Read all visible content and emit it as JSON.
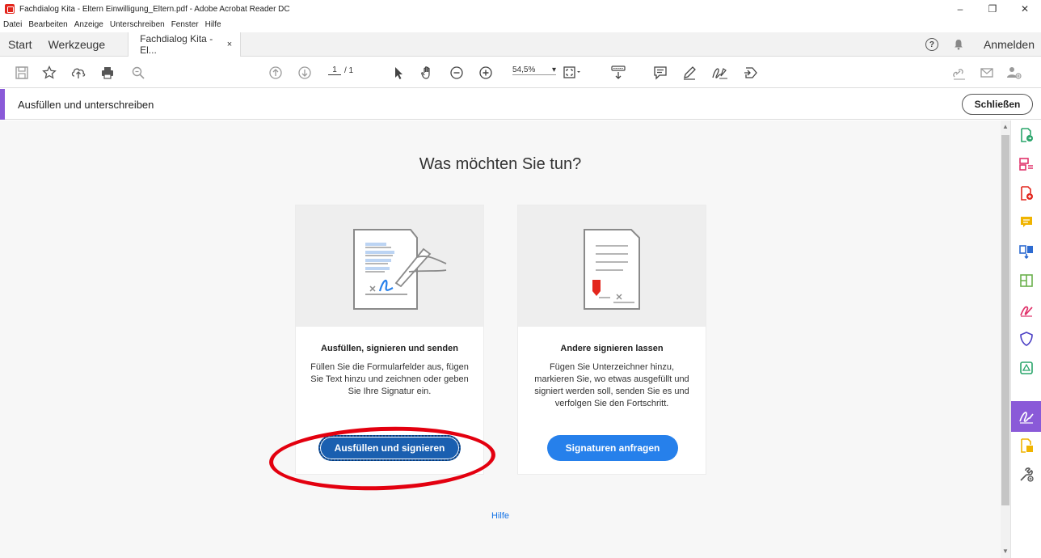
{
  "window": {
    "title": "Fachdialog Kita - Eltern Einwilligung_Eltern.pdf - Adobe Acrobat Reader DC",
    "controls": [
      "–",
      "❐",
      "✕"
    ]
  },
  "menu": [
    "Datei",
    "Bearbeiten",
    "Anzeige",
    "Unterschreiben",
    "Fenster",
    "Hilfe"
  ],
  "tabs": {
    "start": "Start",
    "tools": "Werkzeuge",
    "document": "Fachdialog Kita - El...",
    "close": "×",
    "help_icon": "?",
    "sign_in": "Anmelden"
  },
  "toolbar": {
    "page_current": "1",
    "page_total": "/ 1",
    "zoom": "54,5%",
    "zoom_arrow": "▾"
  },
  "panel": {
    "label": "Ausfüllen und unterschreiben",
    "close_label": "Schließen",
    "accent": "#8a5ad8"
  },
  "main": {
    "headline": "Was möchten Sie tun?",
    "help_link": "Hilfe",
    "cards": [
      {
        "title": "Ausfüllen, signieren und senden",
        "description": "Füllen Sie die Formularfelder aus, fügen Sie Text hinzu und zeichnen oder geben Sie Ihre Signatur ein.",
        "button": "Ausfüllen und signieren"
      },
      {
        "title": "Andere signieren lassen",
        "description": "Fügen Sie Unterzeichner hinzu, markieren Sie, wo etwas ausgefüllt und signiert werden soll, senden Sie es und verfolgen Sie den Fortschritt.",
        "button": "Signaturen anfragen"
      }
    ]
  },
  "colors": {
    "primary_button": "#2680eb",
    "active_button": "#1a5fb0",
    "annotation_ring": "#e3000f",
    "link": "#1473e6"
  },
  "right_rail_icons": [
    "export-pdf-icon",
    "organize-pages-icon",
    "create-pdf-icon",
    "comment-icon",
    "combine-files-icon",
    "edit-pdf-icon",
    "fill-sign-icon",
    "protect-icon",
    "scan-icon",
    "sign-active-icon",
    "more-tools-icon",
    "tools-add-icon"
  ]
}
